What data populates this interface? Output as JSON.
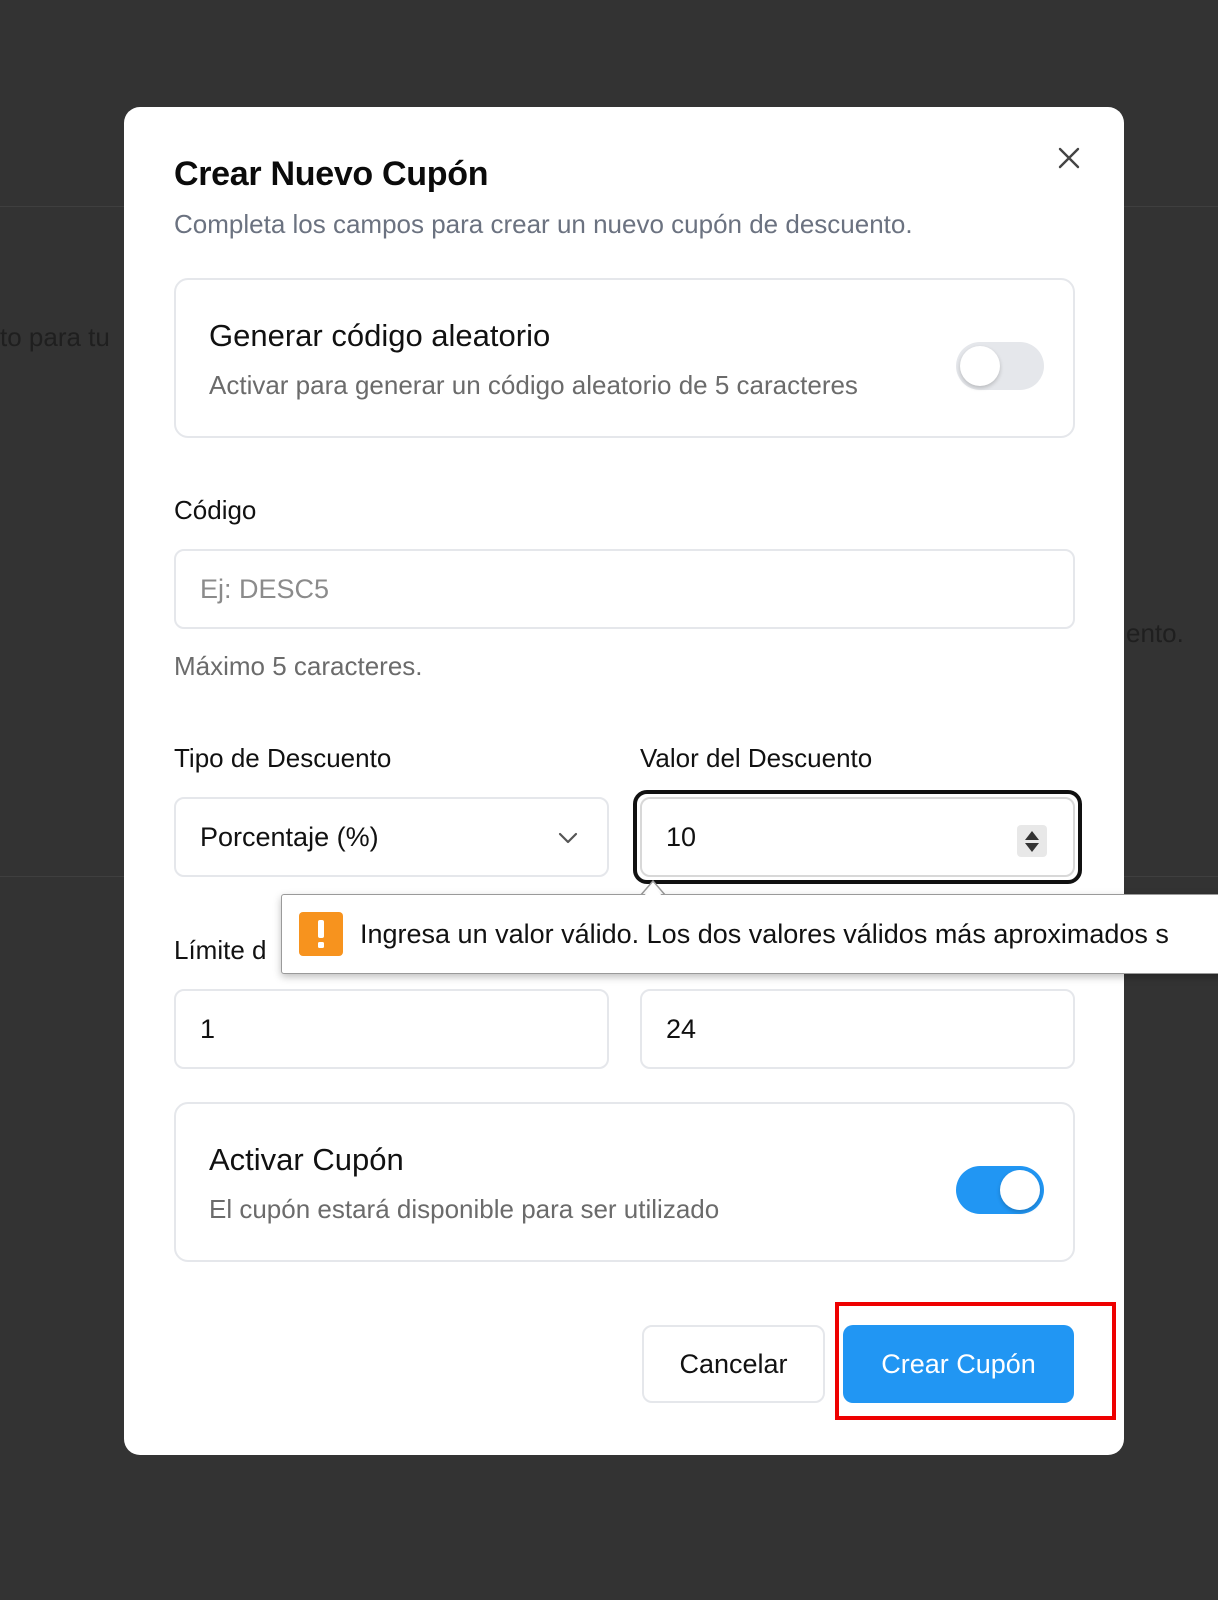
{
  "background": {
    "text_left": "to para tu",
    "text_right": "ento."
  },
  "modal": {
    "title": "Crear Nuevo Cupón",
    "description": "Completa los campos para crear un nuevo cupón de descuento.",
    "random_code": {
      "title": "Generar código aleatorio",
      "subtitle": "Activar para generar un código aleatorio de 5 caracteres",
      "enabled": false
    },
    "code": {
      "label": "Código",
      "placeholder": "Ej: DESC5",
      "value": "",
      "hint": "Máximo 5 caracteres."
    },
    "discount_type": {
      "label": "Tipo de Descuento",
      "value": "Porcentaje (%)"
    },
    "discount_value": {
      "label": "Valor del Descuento",
      "value": "10"
    },
    "usage_limit": {
      "label": "Límite d",
      "value": "1"
    },
    "second_field": {
      "value": "24"
    },
    "activate": {
      "title": "Activar Cupón",
      "subtitle": "El cupón estará disponible para ser utilizado",
      "enabled": true
    },
    "buttons": {
      "cancel": "Cancelar",
      "submit": "Crear Cupón"
    }
  },
  "validation_tooltip": {
    "icon": "warning-icon",
    "message": "Ingresa un valor válido. Los dos valores válidos más aproximados s"
  },
  "colors": {
    "primary": "#2196f3",
    "warning": "#f7931e",
    "highlight": "#ee0000",
    "overlay": "#333333"
  }
}
